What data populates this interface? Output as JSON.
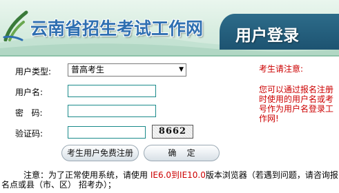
{
  "banner": {
    "title": "云南省招生考试工作网",
    "login_title": "用户登录"
  },
  "form": {
    "user_type": {
      "label": "用户类型:",
      "selected": "普高考生"
    },
    "username": {
      "label": "用户名:",
      "value": ""
    },
    "password": {
      "label": "密   码:",
      "value": ""
    },
    "captcha": {
      "label": "验证码:",
      "value": "",
      "image_text": "8662"
    },
    "register_button": "考生用户免费注册",
    "confirm_button": "确    定"
  },
  "notice": {
    "title": "考生请注意:",
    "body": "您可以通过报名注册时使用的用户名或考号作为用户名登录工作网!"
  },
  "footer": {
    "prefix": "注意：为了正常使用系统，请使用 ",
    "browser": "IE6.0到IE10.0",
    "suffix": "版本浏览器（若遇到问题，请咨询报名点或县（市、区） 招考办）；"
  },
  "colors": {
    "accent_red": "#cc0000",
    "title_blue": "#2f6fb1",
    "banner_dark": "#1d5371"
  }
}
